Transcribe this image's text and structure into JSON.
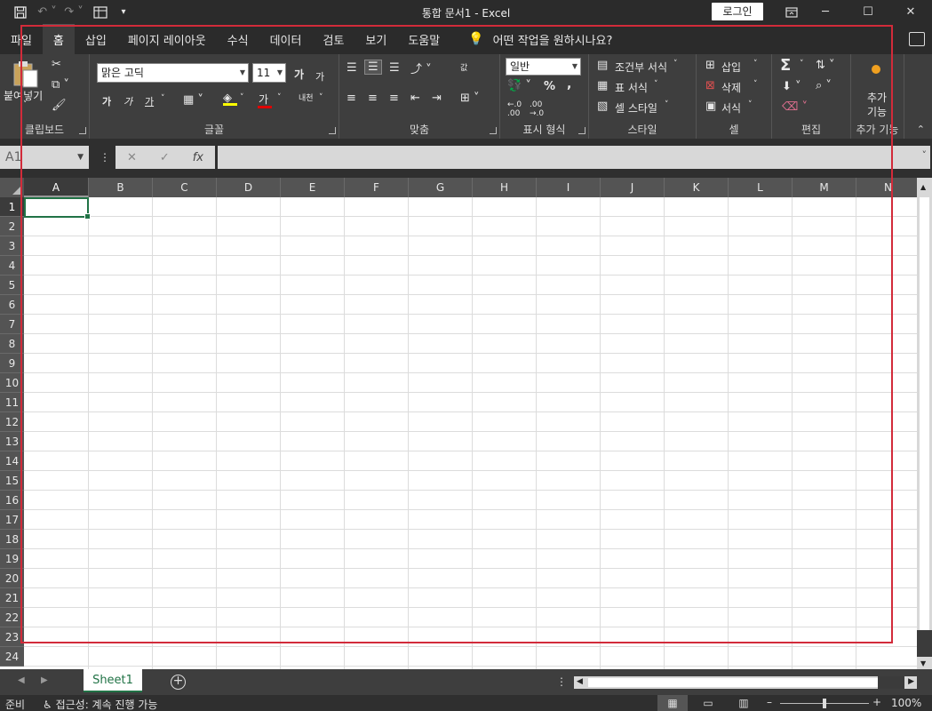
{
  "window": {
    "doc_title": "통합 문서1  -  Excel",
    "login_label": "로그인",
    "minimize": "─",
    "restore": "☐",
    "close": "✕"
  },
  "tabs": [
    {
      "label": "파일"
    },
    {
      "label": "홈",
      "active": true
    },
    {
      "label": "삽입"
    },
    {
      "label": "페이지 레이아웃"
    },
    {
      "label": "수식"
    },
    {
      "label": "데이터"
    },
    {
      "label": "검토"
    },
    {
      "label": "보기"
    },
    {
      "label": "도움말"
    }
  ],
  "tell_me": "어떤 작업을 원하시나요?",
  "ribbon": {
    "clipboard": {
      "paste_label": "붙여넣기",
      "group_label": "클립보드"
    },
    "font": {
      "font_name": "맑은 고딕",
      "font_size": "11",
      "group_label": "글꼴",
      "grow": "가",
      "shrink": "가",
      "bold": "가",
      "italic": "가",
      "underline": "가",
      "font_color": "가",
      "phonetic": "내천"
    },
    "alignment": {
      "group_label": "맞춤",
      "wrap": "값"
    },
    "number": {
      "format": "일반",
      "group_label": "표시 형식",
      "percent": "%",
      "comma": ","
    },
    "styles": {
      "conditional": "조건부 서식",
      "table": "표 서식",
      "cell_style": "셀 스타일",
      "group_label": "스타일"
    },
    "cells": {
      "insert": "삽입",
      "delete": "삭제",
      "format": "서식",
      "group_label": "셀"
    },
    "editing": {
      "group_label": "편집",
      "sum": "Σ"
    },
    "addins": {
      "label_line1": "추가",
      "label_line2": "기능",
      "group_label": "추가 기능"
    }
  },
  "formula_bar": {
    "namebox": "A1",
    "cancel": "✕",
    "enter": "✓",
    "fx": "fx"
  },
  "columns": [
    "A",
    "B",
    "C",
    "D",
    "E",
    "F",
    "G",
    "H",
    "I",
    "J",
    "K",
    "L",
    "M",
    "N"
  ],
  "rows": [
    "1",
    "2",
    "3",
    "4",
    "5",
    "6",
    "7",
    "8",
    "9",
    "10",
    "11",
    "12",
    "13",
    "14",
    "15",
    "16",
    "17",
    "18",
    "19",
    "20",
    "21",
    "22",
    "23",
    "24"
  ],
  "sheets": [
    {
      "label": "Sheet1",
      "active": true
    }
  ],
  "status": {
    "ready": "준비",
    "accessibility": "접근성: 계속 진행 가능",
    "zoom": "100%"
  }
}
